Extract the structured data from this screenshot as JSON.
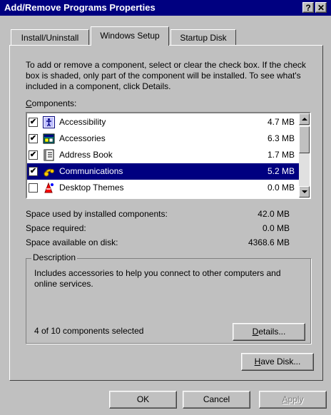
{
  "window": {
    "title": "Add/Remove Programs Properties",
    "help_glyph": "?",
    "close_glyph": "✕"
  },
  "tabs": [
    {
      "label": "Install/Uninstall",
      "active": false
    },
    {
      "label": "Windows Setup",
      "active": true
    },
    {
      "label": "Startup Disk",
      "active": false
    }
  ],
  "intro_text": "To add or remove a component, select or clear the check box. If the check box is shaded, only part of the component will be installed. To see what's included in a component, click Details.",
  "components_label": "Components:",
  "components": [
    {
      "name": "Accessibility",
      "size": "4.7 MB",
      "checked": true,
      "selected": false,
      "icon": "accessibility-icon"
    },
    {
      "name": "Accessories",
      "size": "6.3 MB",
      "checked": true,
      "selected": false,
      "icon": "accessories-icon"
    },
    {
      "name": "Address Book",
      "size": "1.7 MB",
      "checked": true,
      "selected": false,
      "icon": "address-book-icon"
    },
    {
      "name": "Communications",
      "size": "5.2 MB",
      "checked": true,
      "selected": true,
      "icon": "communications-icon"
    },
    {
      "name": "Desktop Themes",
      "size": "0.0 MB",
      "checked": false,
      "selected": false,
      "icon": "desktop-themes-icon"
    }
  ],
  "space": {
    "used_label": "Space used by installed components:",
    "used_value": "42.0 MB",
    "required_label": "Space required:",
    "required_value": "0.0 MB",
    "available_label": "Space available on disk:",
    "available_value": "4368.6 MB"
  },
  "description": {
    "title": "Description",
    "text": "Includes accessories to help you connect to other computers and online services.",
    "count_text": "4 of 10 components selected"
  },
  "buttons": {
    "details": "Details...",
    "have_disk": "Have Disk...",
    "ok": "OK",
    "cancel": "Cancel",
    "apply": "Apply"
  },
  "colors": {
    "titlebar": "#000080",
    "selection": "#000080",
    "face": "#c0c0c0"
  }
}
